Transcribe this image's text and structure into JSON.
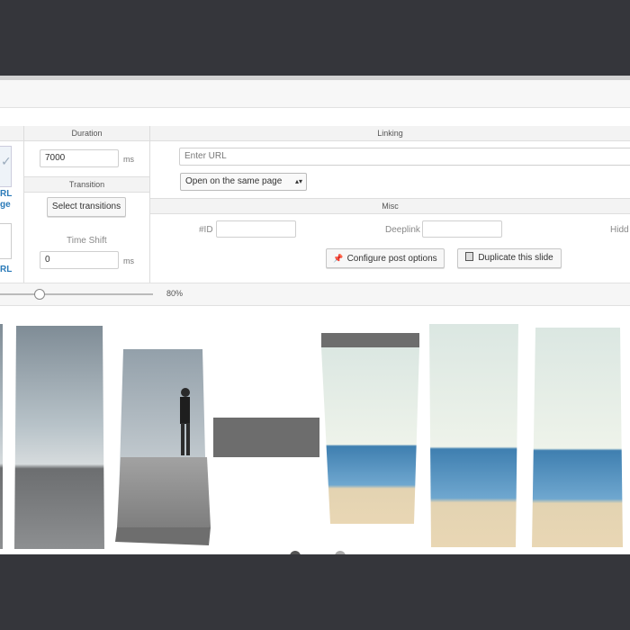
{
  "duration": {
    "header": "Duration",
    "value": "7000",
    "unit": "ms"
  },
  "transition": {
    "header": "Transition",
    "button": "Select transitions"
  },
  "timeshift": {
    "label": "Time Shift",
    "value": "0",
    "unit": "ms"
  },
  "linking": {
    "header": "Linking",
    "url_placeholder": "Enter URL",
    "target_select": "Open on the same page"
  },
  "misc": {
    "header": "Misc",
    "id_label": "#ID",
    "deeplink_label": "Deeplink",
    "hidden_label": "Hidd",
    "configure_button": "Configure post options",
    "duplicate_button": "Duplicate this slide"
  },
  "left_panel": {
    "label_a": "RL",
    "label_b": "ge",
    "label_c": "RL"
  },
  "zoom": {
    "value": 0.8,
    "label": "80%"
  },
  "colors": {
    "accent_link": "#2a7ab8",
    "frame": "#35363b"
  }
}
